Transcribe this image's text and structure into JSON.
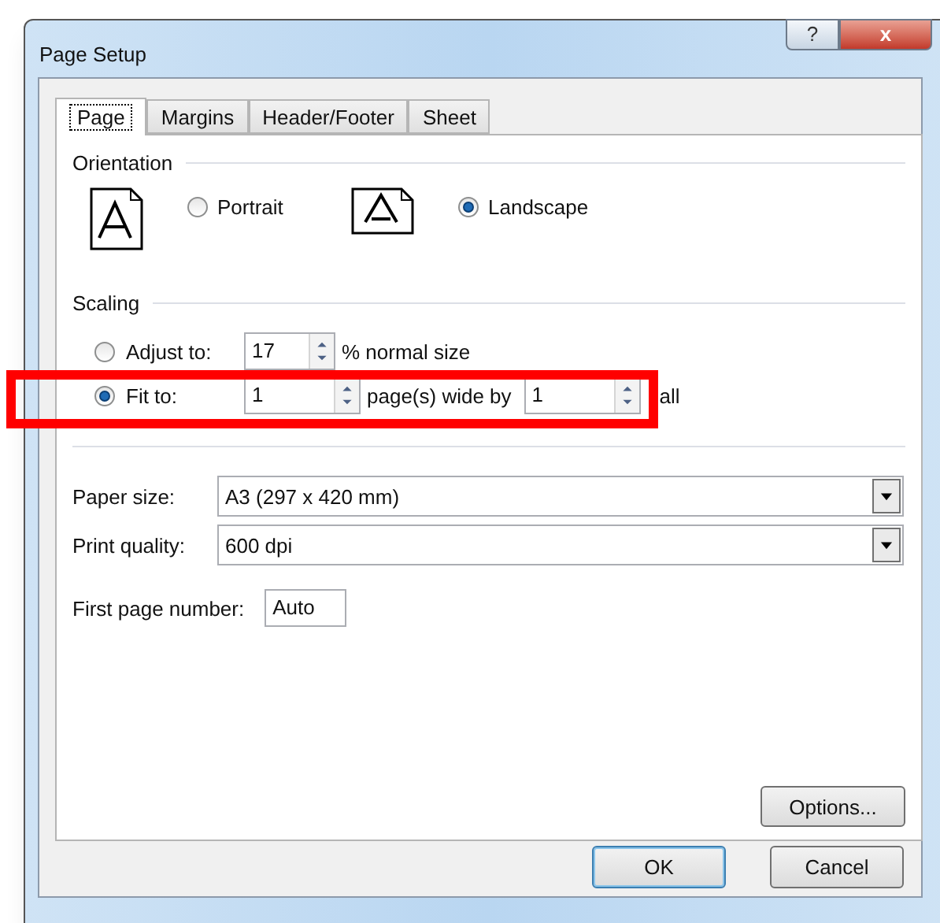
{
  "window": {
    "title": "Page Setup",
    "buttons": [
      "?",
      "x"
    ]
  },
  "tabs": [
    {
      "label": "Page",
      "selected": true
    },
    {
      "label": "Margins",
      "selected": false
    },
    {
      "label": "Header/Footer",
      "selected": false
    },
    {
      "label": "Sheet",
      "selected": false
    }
  ],
  "orientation": {
    "title": "Orientation",
    "options": [
      {
        "label": "Portrait",
        "selected": false,
        "kind": "portrait"
      },
      {
        "label": "Landscape",
        "selected": true,
        "kind": "landscape"
      }
    ]
  },
  "scaling": {
    "title": "Scaling",
    "adjust": {
      "label": "Adjust to:",
      "selected": false,
      "value": "17",
      "suffix": "% normal size"
    },
    "fit": {
      "label": "Fit to:",
      "selected": true,
      "wide": "1",
      "middle": "page(s) wide by",
      "tall": "1",
      "suffix": "all"
    },
    "highlight": true
  },
  "paper_size": {
    "label": "Paper size:",
    "value": "A3 (297 x 420 mm)"
  },
  "print_quality": {
    "label": "Print quality:",
    "value": "600 dpi"
  },
  "first_page_number": {
    "label": "First page number:",
    "value": "Auto"
  },
  "options_button": "Options...",
  "buttons": [
    {
      "label": "OK",
      "default": true
    },
    {
      "label": "Cancel",
      "default": false
    }
  ]
}
